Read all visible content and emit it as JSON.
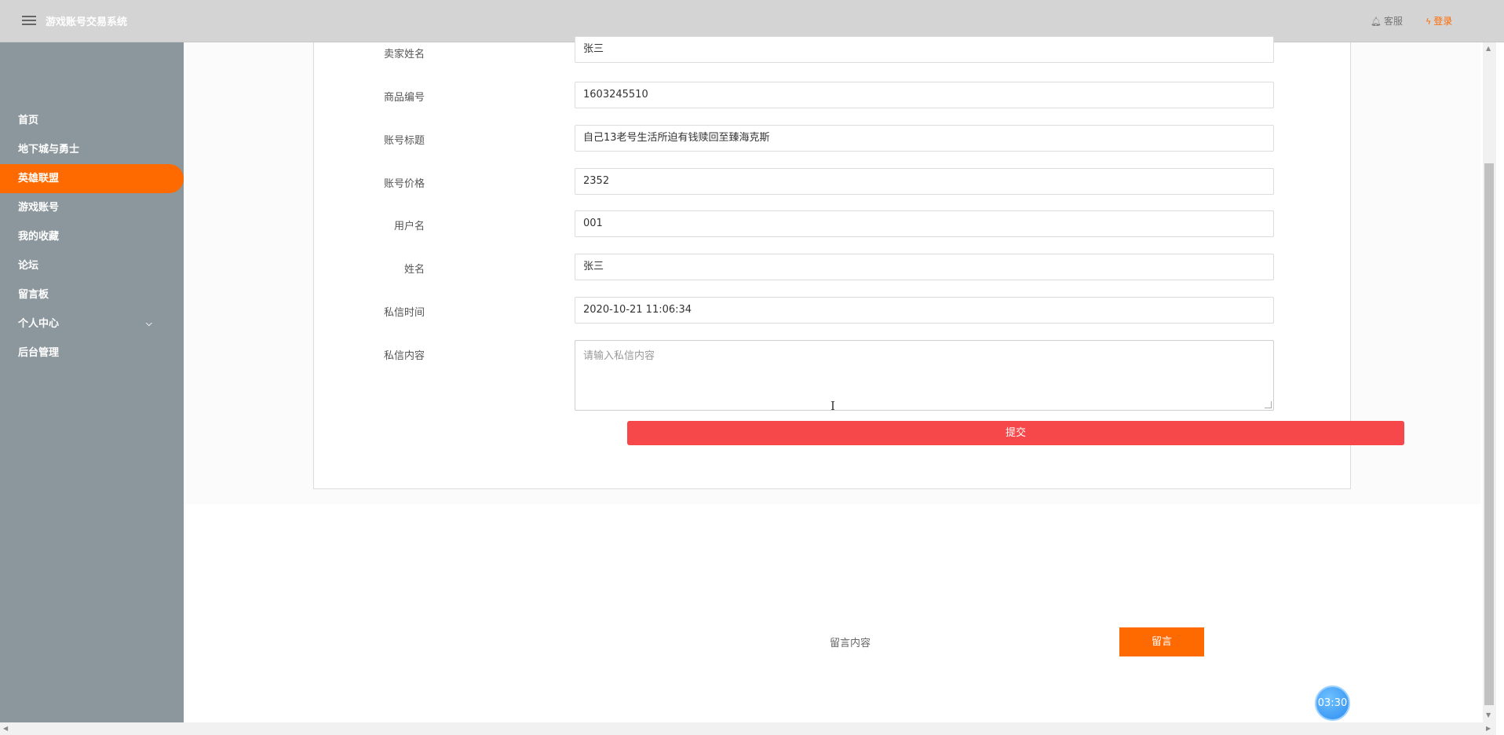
{
  "header": {
    "app_title": "游戏账号交易系统",
    "service_label": "客服",
    "login_label": "登录"
  },
  "sidebar": {
    "items": [
      {
        "label": "首页"
      },
      {
        "label": "地下城与勇士"
      },
      {
        "label": "英雄联盟"
      },
      {
        "label": "游戏账号"
      },
      {
        "label": "我的收藏"
      },
      {
        "label": "论坛"
      },
      {
        "label": "留言板"
      },
      {
        "label": "个人中心"
      },
      {
        "label": "后台管理"
      }
    ],
    "active_item": "英雄联盟"
  },
  "form": {
    "fields": [
      {
        "label": "卖家姓名",
        "value": "张三"
      },
      {
        "label": "商品编号",
        "value": "1603245510"
      },
      {
        "label": "账号标题",
        "value": "自己13老号生活所迫有钱赎回至臻海克斯"
      },
      {
        "label": "账号价格",
        "value": "2352"
      },
      {
        "label": "用户名",
        "value": "001"
      },
      {
        "label": "姓名",
        "value": "张三"
      },
      {
        "label": "私信时间",
        "value": "2020-10-21 11:06:34"
      }
    ],
    "message_label": "私信内容",
    "message_placeholder": "请输入私信内容",
    "submit_label": "提交"
  },
  "guestbook": {
    "input_placeholder": "留言内容",
    "button_label": "留言"
  },
  "timer": "03:30"
}
